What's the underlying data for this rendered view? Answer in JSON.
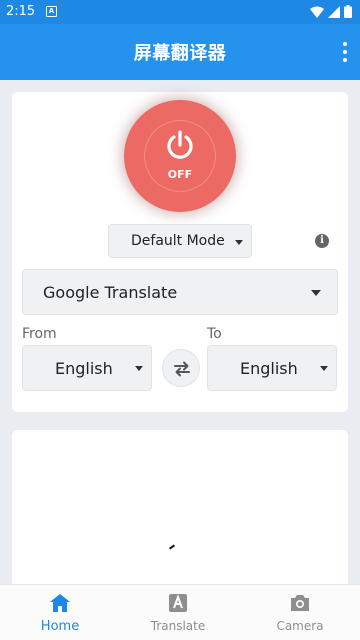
{
  "status_bar": {
    "time": "2:15",
    "notif_badge": "A"
  },
  "app_bar": {
    "title": "屏幕翻译器"
  },
  "power": {
    "state_label": "OFF",
    "color": "#ec6a63"
  },
  "mode_select": {
    "value": "Default Mode"
  },
  "engine_select": {
    "value": "Google Translate"
  },
  "languages": {
    "from_label": "From",
    "to_label": "To",
    "from_value": "English",
    "to_value": "English"
  },
  "bottom_nav": {
    "items": [
      {
        "label": "Home",
        "icon": "home-icon",
        "active": true
      },
      {
        "label": "Translate",
        "icon": "translate-icon",
        "active": false
      },
      {
        "label": "Camera",
        "icon": "camera-icon",
        "active": false
      }
    ]
  },
  "colors": {
    "primary": "#1e88e5",
    "app_bar": "#2592ee",
    "background": "#e9ecf1"
  }
}
